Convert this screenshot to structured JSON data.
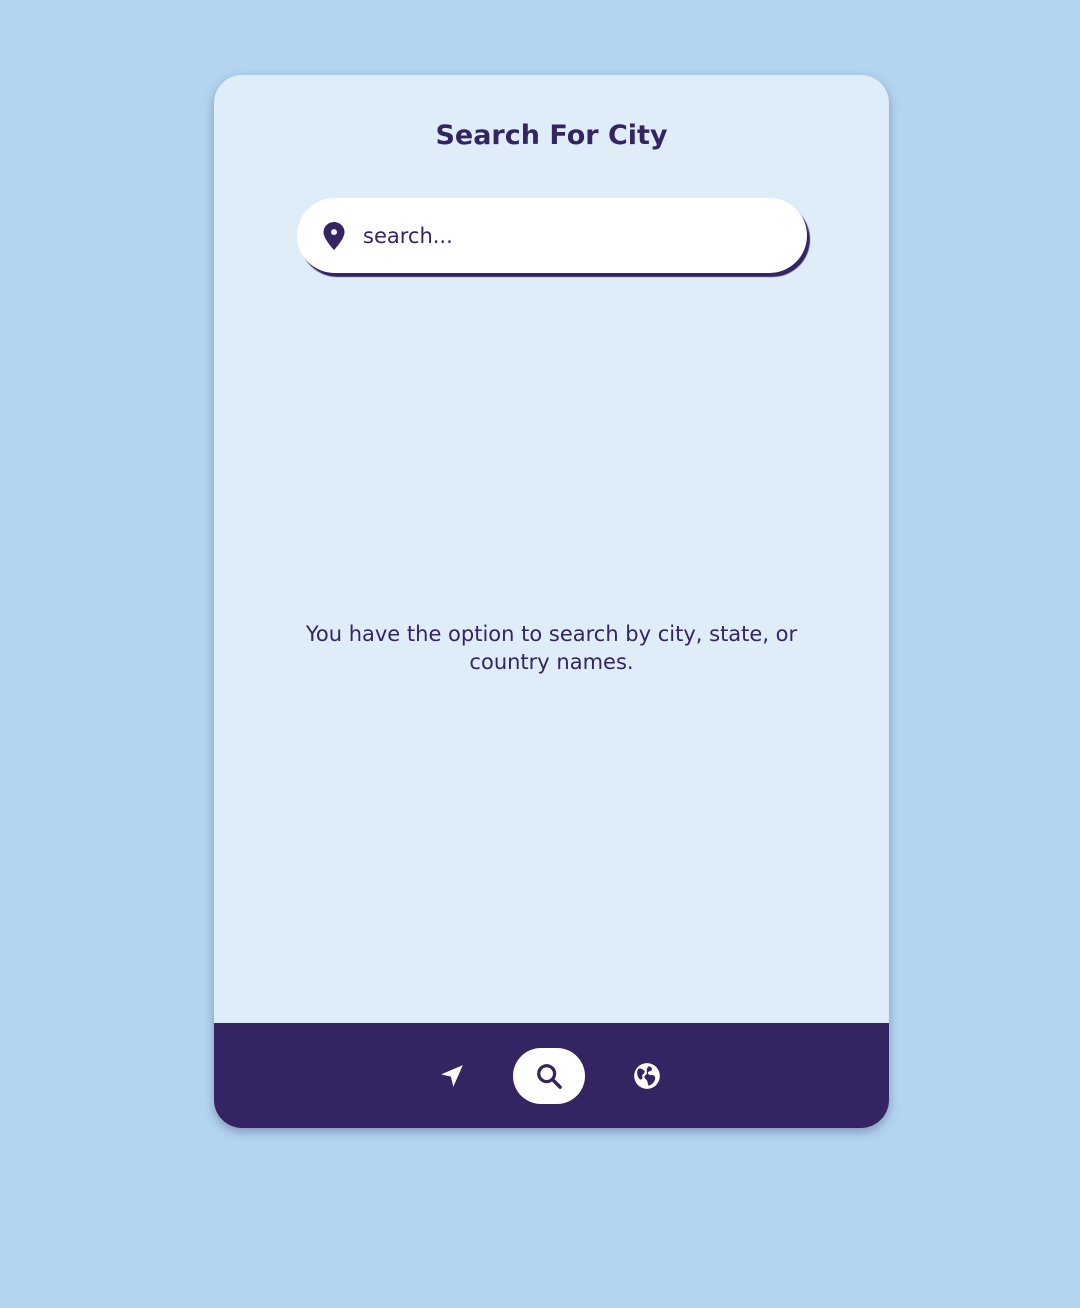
{
  "header": {
    "title": "Search For City"
  },
  "search": {
    "placeholder": "search...",
    "value": "",
    "icon": "map-pin-icon"
  },
  "main": {
    "hint": "You have the option to search by city, state, or country names."
  },
  "nav": {
    "items": [
      {
        "icon": "location-arrow-icon",
        "active": false
      },
      {
        "icon": "search-icon",
        "active": true
      },
      {
        "icon": "globe-icon",
        "active": false
      }
    ]
  },
  "colors": {
    "background": "#b3d5f0",
    "card": "#dfedf9",
    "primary": "#352462",
    "white": "#ffffff"
  }
}
